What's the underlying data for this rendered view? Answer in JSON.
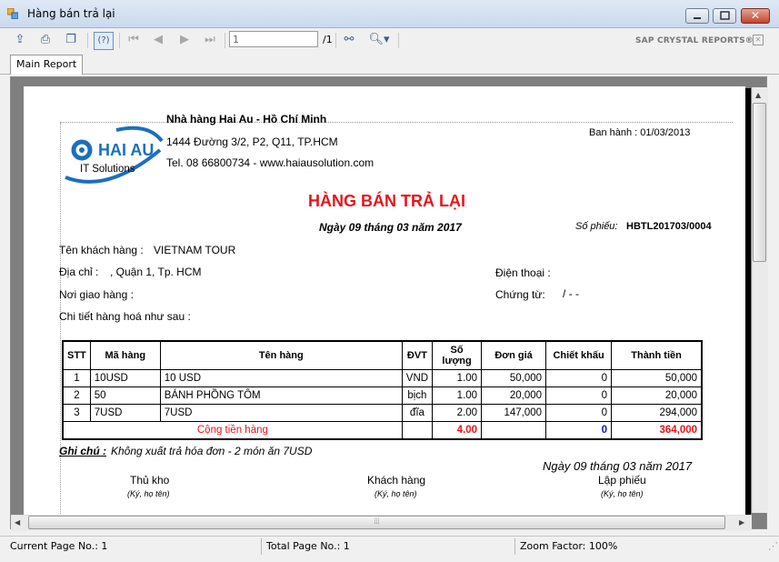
{
  "window": {
    "title": "Hàng bán trả lại"
  },
  "toolbar": {
    "page_value": "1",
    "page_total": "/1",
    "brand": "SAP CRYSTAL REPORTS®"
  },
  "tabs": [
    {
      "label": "Main Report"
    }
  ],
  "report": {
    "company_name": "Nhà hàng Hai Au - Hồ Chí Minh",
    "company_address": "1444 Đường 3/2, P2, Q11, TP.HCM",
    "company_contact": "Tel. 08 66800734 - www.haiausolution.com",
    "issued": "Ban hành : 01/03/2013",
    "logo_text": "HAI AU",
    "logo_sub": "IT Solutions",
    "title": "HÀNG BÁN TRẢ LẠI",
    "date": "Ngày 09 tháng 03 năm 2017",
    "voucher_label": "Số phiếu:",
    "voucher_no": "HBTL201703/0004",
    "customer_label": "Tên khách hàng :",
    "customer_value": "VIETNAM TOUR",
    "address_label": "Địa chỉ  :",
    "address_value": ", Quận 1, Tp. HCM",
    "phone_label": "Điện thoại :",
    "delivery_label": "Nơi giao hàng  :",
    "doc_label": "Chứng từ:",
    "doc_value": "/  -  -",
    "detail_label": "Chi tiết hàng hoá như sau :",
    "columns": [
      "STT",
      "Mã hàng",
      "Tên hàng",
      "ĐVT",
      "Số lượng",
      "Đơn giá",
      "Chiết khấu",
      "Thành  tiền"
    ],
    "rows": [
      [
        "1",
        "10USD",
        "10 USD",
        "VND",
        "1.00",
        "50,000",
        "0",
        "50,000"
      ],
      [
        "2",
        "50",
        "BÁNH PHỒNG TÔM",
        "bịch",
        "1.00",
        "20,000",
        "0",
        "20,000"
      ],
      [
        "3",
        "7USD",
        "7USD",
        "đĩa",
        "2.00",
        "147,000",
        "0",
        "294,000"
      ]
    ],
    "total_label": "Cộng tiền hàng",
    "total_qty": "4.00",
    "total_discount": "0",
    "total_amount": "364,000",
    "note_label": "Ghi chú :",
    "note_value": "Không xuất trả hóa đơn - 2 món ăn 7USD",
    "sign_date": "Ngày 09 tháng 03 năm 2017",
    "signers": [
      {
        "title": "Thủ kho",
        "hint": "(Ký, họ tên)"
      },
      {
        "title": "Khách hàng",
        "hint": "(Ký, họ tên)"
      },
      {
        "title": "Lập phiếu",
        "hint": "(Ký, họ tên)"
      }
    ]
  },
  "status": {
    "current_page": "Current Page No.: 1",
    "total_page": "Total Page No.: 1",
    "zoom": "Zoom Factor: 100%"
  },
  "colors": {
    "title_red": "#e8141b",
    "total_red": "#e8141b",
    "total_blue": "#1010d0",
    "logo_blue": "#1a6fc0"
  }
}
